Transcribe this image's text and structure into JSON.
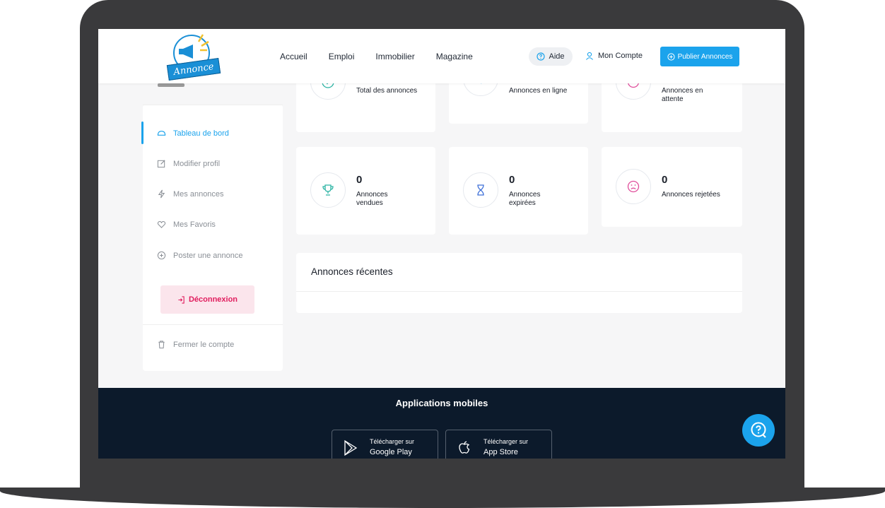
{
  "header": {
    "logo_text": "Annonce",
    "nav": [
      "Accueil",
      "Emploi",
      "Immobilier",
      "Magazine"
    ],
    "aide_label": "Aide",
    "compte_label": "Mon Compte",
    "publier_label": "Publier Annonces"
  },
  "sidebar": {
    "items": [
      {
        "label": "Tableau de bord",
        "icon": "dashboard-icon",
        "active": true
      },
      {
        "label": "Modifier profil",
        "icon": "edit-icon"
      },
      {
        "label": "Mes annonces",
        "icon": "bolt-icon"
      },
      {
        "label": "Mes Favoris",
        "icon": "heart-icon"
      },
      {
        "label": "Poster une annonce",
        "icon": "plus-circle-icon"
      }
    ],
    "logout_label": "Déconnexion",
    "close_account_label": "Fermer le compte"
  },
  "stats": {
    "total": {
      "label": "Total des annonces",
      "icon": "check-circle-icon"
    },
    "online": {
      "label": "Annonces en ligne",
      "icon": "send-icon"
    },
    "pending": {
      "label": "Annonces en attente",
      "icon": "clock-icon"
    },
    "sold": {
      "value": "0",
      "label": "Annonces vendues",
      "icon": "trophy-icon"
    },
    "expired": {
      "value": "0",
      "label": "Annonces expirées",
      "icon": "hourglass-icon"
    },
    "rejected": {
      "value": "0",
      "label": "Annonces rejetées",
      "icon": "sad-face-icon"
    }
  },
  "recent": {
    "title": "Annonces récentes"
  },
  "footer": {
    "title": "Applications mobiles",
    "google": {
      "sub": "Télécharger sur",
      "name": "Google Play"
    },
    "apple": {
      "sub": "Télécharger sur",
      "name": "App Store"
    }
  },
  "colors": {
    "accent": "#1ba3ec",
    "footer": "#0c1a2b",
    "logout_bg": "#fbe5ec",
    "logout_text": "#e11d5e"
  }
}
